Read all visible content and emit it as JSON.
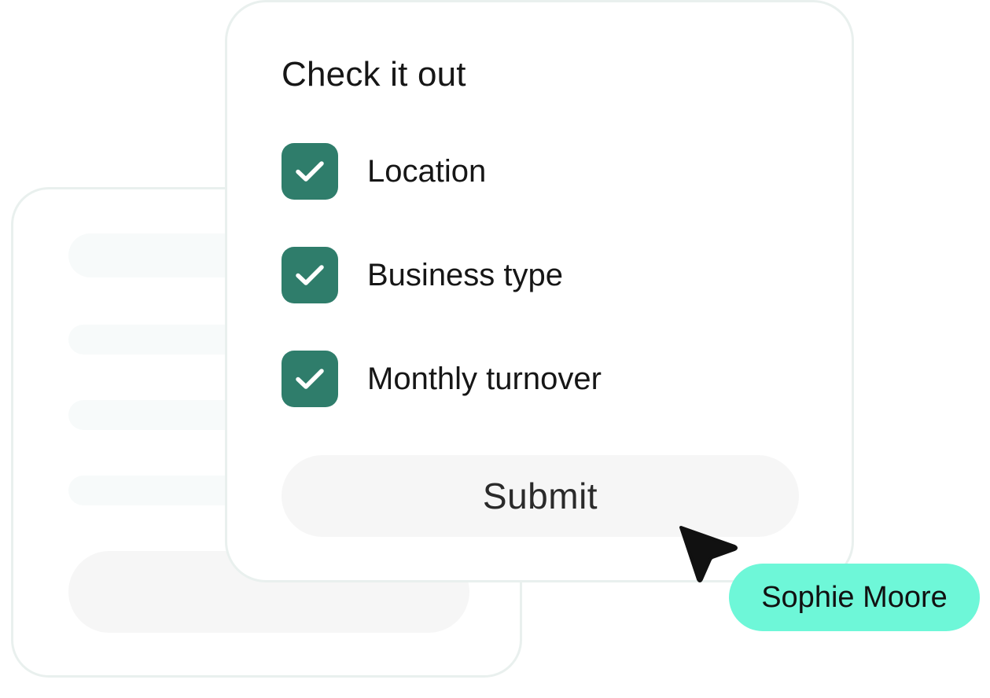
{
  "form": {
    "title": "Check it out",
    "items": [
      {
        "label": "Location",
        "checked": true
      },
      {
        "label": "Business type",
        "checked": true
      },
      {
        "label": "Monthly turnover",
        "checked": true
      }
    ],
    "submit_label": "Submit"
  },
  "collaborator": {
    "name": "Sophie Moore"
  },
  "icons": {
    "checkbox": "check-icon",
    "cursor": "cursor-arrow-icon"
  },
  "colors": {
    "checkbox_fill": "#2f7d6b",
    "name_tag": "#6ef7d8",
    "button_bg": "#f6f6f6",
    "card_border": "#e9f0ee"
  }
}
